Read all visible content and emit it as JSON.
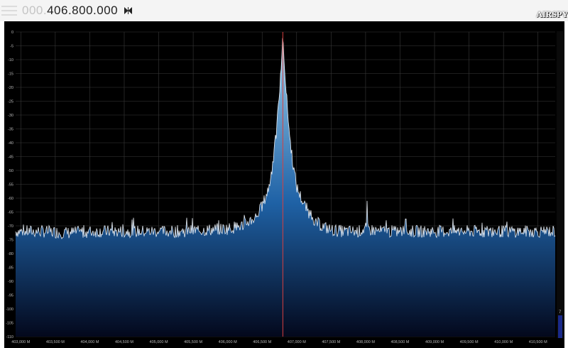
{
  "toolbar": {
    "frequency_prefix": "000.",
    "frequency_main": "406.800.000",
    "brand": "AIRSPY"
  },
  "level_meter": {
    "label": "7"
  },
  "colors": {
    "background": "#000000",
    "grid": "#3a3a3a",
    "trace": "#e8eef5",
    "fill_top": "#9fd0ec",
    "fill_mid": "#1f62a6",
    "fill_bottom": "#03081c",
    "center_line": "#d84040"
  },
  "chart_data": {
    "type": "area",
    "xlabel": "",
    "ylabel": "",
    "x_unit": "MHz",
    "xlim": [
      402.925,
      410.75
    ],
    "ylim": [
      -110,
      0
    ],
    "y_ticks": [
      0,
      -5,
      -10,
      -15,
      -20,
      -25,
      -30,
      -35,
      -40,
      -45,
      -50,
      -55,
      -60,
      -65,
      -70,
      -75,
      -80,
      -85,
      -90,
      -95,
      -100,
      -105,
      -110
    ],
    "y_tick_labels": [
      "0",
      "-5",
      "-10",
      "-15",
      "-20",
      "-25",
      "-30",
      "-35",
      "-40",
      "-45",
      "-50",
      "-55",
      "-60",
      "-65",
      "-70",
      "-75",
      "-80",
      "-85",
      "-90",
      "-95",
      "-100",
      "-105",
      "-110"
    ],
    "x_ticks": [
      403.0,
      403.5,
      404.0,
      404.5,
      405.0,
      405.5,
      406.0,
      406.5,
      407.0,
      407.5,
      408.0,
      408.5,
      409.0,
      409.5,
      410.0,
      410.5
    ],
    "x_tick_labels": [
      "403,000 M",
      "403,500 M",
      "404,000 M",
      "404,500 M",
      "405,000 M",
      "405,500 M",
      "406,000 M",
      "406,500 M",
      "407,000 M",
      "407,500 M",
      "408,000 M",
      "408,500 M",
      "409,000 M",
      "409,500 M",
      "410,000 M",
      "410,500 M"
    ],
    "center_frequency": 406.8,
    "grid": true,
    "noise_floor": -72,
    "series": [
      {
        "x": [
          402.95,
          403.3,
          403.7,
          404.1,
          404.5,
          404.9,
          405.3,
          405.7,
          406.0,
          406.2,
          406.4,
          406.5,
          406.6,
          406.65,
          406.7,
          406.75,
          406.78,
          406.8,
          406.82,
          406.85,
          406.9,
          406.95,
          407.0,
          407.1,
          407.2,
          407.3,
          407.4,
          407.5,
          407.7,
          407.9,
          408.0,
          408.2,
          408.4,
          408.6,
          408.8,
          409.0,
          409.2,
          409.4,
          409.6,
          409.8,
          410.0,
          410.2,
          410.4,
          410.7
        ],
        "y": [
          -72,
          -72,
          -72.5,
          -72,
          -72,
          -72,
          -72,
          -71.5,
          -71,
          -70,
          -67,
          -63,
          -56,
          -48,
          -38,
          -22,
          -12,
          0,
          -12,
          -22,
          -38,
          -48,
          -56,
          -62,
          -66,
          -69,
          -70.5,
          -71.5,
          -72,
          -72,
          -71,
          -72,
          -72,
          -72,
          -72,
          -72,
          -72,
          -72,
          -72,
          -72,
          -72,
          -72,
          -72,
          -72
        ]
      }
    ],
    "spikes": [
      {
        "x": 408.02,
        "y": -61
      },
      {
        "x": 408.3,
        "y": -68
      },
      {
        "x": 408.58,
        "y": -67.5
      },
      {
        "x": 407.42,
        "y": -69
      }
    ]
  }
}
